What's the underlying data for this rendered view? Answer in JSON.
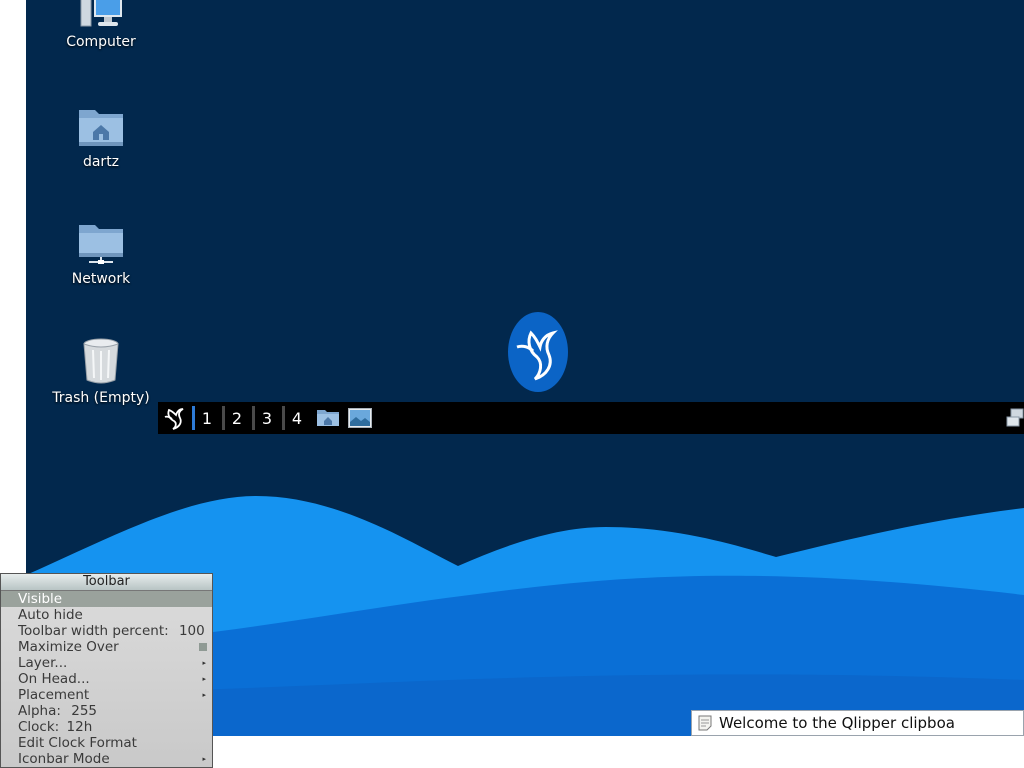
{
  "desktop": {
    "icons": [
      {
        "label": "Computer",
        "icon": "computer-icon"
      },
      {
        "label": "dartz",
        "icon": "home-folder-icon"
      },
      {
        "label": "Network",
        "icon": "network-folder-icon"
      },
      {
        "label": "Trash (Empty)",
        "icon": "trash-icon"
      }
    ],
    "center_logo": "lxqt-bird-logo"
  },
  "toolbar": {
    "start_icon": "bird-menu-icon",
    "workspaces": [
      "1",
      "2",
      "3",
      "4"
    ],
    "active_workspace": "1",
    "launchers": [
      "file-manager-icon",
      "image-viewer-icon"
    ],
    "tray": [
      "network-icon"
    ]
  },
  "toolbar_menu": {
    "title": "Toolbar",
    "items": [
      {
        "label": "Visible",
        "highlighted": true
      },
      {
        "label": "Auto hide"
      },
      {
        "label": "Toolbar width percent:",
        "value": "100"
      },
      {
        "label": "Maximize Over",
        "checkbox": true
      },
      {
        "label": "Layer...",
        "submenu": true
      },
      {
        "label": "On Head...",
        "submenu": true
      },
      {
        "label": "Placement",
        "submenu": true
      },
      {
        "label": "Alpha:",
        "value": "255"
      },
      {
        "label": "Clock:",
        "value": "12h"
      },
      {
        "label": "Edit Clock Format"
      },
      {
        "label": "Iconbar Mode",
        "submenu": true
      }
    ]
  },
  "notification": {
    "text": "Welcome to the Qlipper clipboa",
    "icon": "note-icon"
  },
  "colors": {
    "desktop_bg": "#02284d",
    "wave_light": "#1593f0",
    "wave_dark": "#0a6fd6",
    "active_workspace": "#2e7bd6"
  }
}
